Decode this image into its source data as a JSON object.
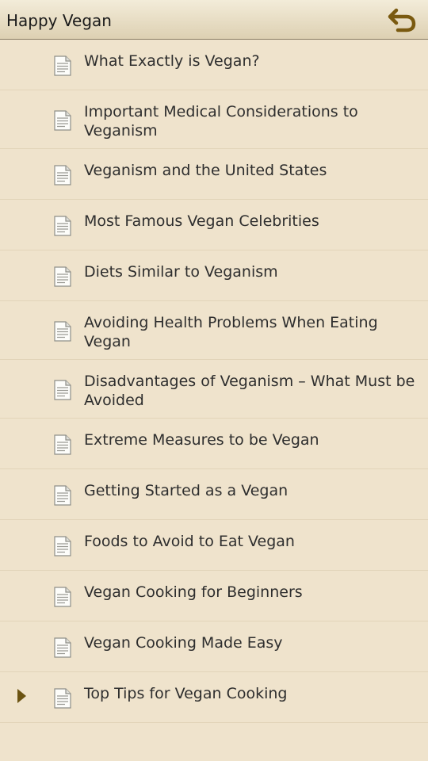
{
  "app_bar": {
    "title": "Happy Vegan",
    "back_icon": "undo-arrow-icon",
    "accent_color": "#7a5a10"
  },
  "chapters": [
    {
      "label": "What Exactly is Vegan?",
      "icon": "document-icon"
    },
    {
      "label": "Important Medical Considerations to Veganism",
      "icon": "document-icon"
    },
    {
      "label": "Veganism and the United States",
      "icon": "document-icon"
    },
    {
      "label": "Most Famous Vegan Celebrities",
      "icon": "document-icon"
    },
    {
      "label": "Diets Similar to Veganism",
      "icon": "document-icon"
    },
    {
      "label": "Avoiding Health Problems When Eating Vegan",
      "icon": "document-icon"
    },
    {
      "label": "Disadvantages of Veganism – What Must be Avoided",
      "icon": "document-icon"
    },
    {
      "label": "Extreme Measures to be Vegan",
      "icon": "document-icon"
    },
    {
      "label": "Getting Started as a Vegan",
      "icon": "document-icon"
    },
    {
      "label": "Foods to Avoid to Eat Vegan",
      "icon": "document-icon"
    },
    {
      "label": "Vegan Cooking for Beginners",
      "icon": "document-icon"
    },
    {
      "label": "Vegan Cooking Made Easy",
      "icon": "document-icon"
    },
    {
      "label": "Top Tips for Vegan Cooking",
      "icon": "document-icon",
      "current": true
    }
  ]
}
